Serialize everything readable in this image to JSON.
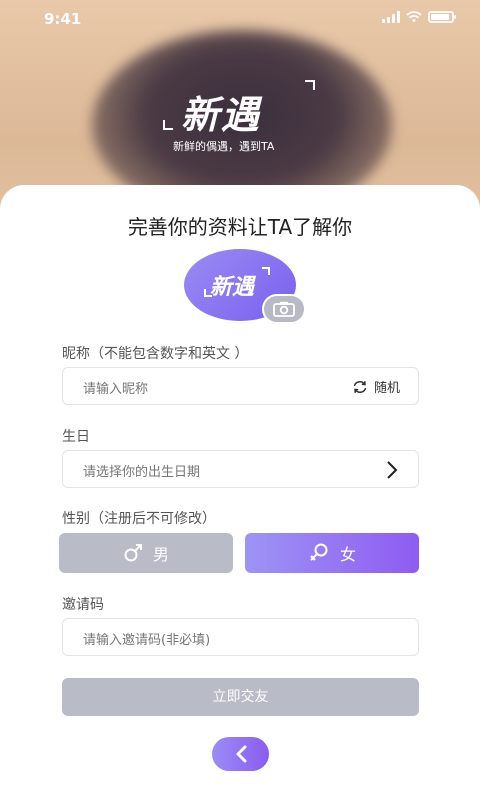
{
  "status_bar": {
    "time": "9:41"
  },
  "hero": {
    "brand": "新遇",
    "tagline": "新鲜的偶遇，遇到TA"
  },
  "form": {
    "title": "完善你的资料让TA了解你",
    "avatar_text": "新遇",
    "nickname": {
      "label": "昵称（不能包含数字和英文 ）",
      "placeholder": "请输入昵称",
      "random_label": "随机"
    },
    "birthday": {
      "label": "生日",
      "placeholder": "请选择你的出生日期"
    },
    "gender": {
      "label": "性别（注册后不可修改）",
      "male": "男",
      "female": "女",
      "selected": "女"
    },
    "invite": {
      "label": "邀请码",
      "placeholder": "请输入邀请码(非必填)"
    },
    "submit_label": "立即交友"
  },
  "icons": {
    "camera": "camera-icon",
    "refresh": "refresh-icon",
    "chevron": "chevron-right-icon",
    "male": "male-icon",
    "female": "female-icon",
    "back": "chevron-left-icon"
  },
  "colors": {
    "accent_start": "#9d94f5",
    "accent_end": "#8e5cf1",
    "disabled": "#b9bbc6"
  }
}
